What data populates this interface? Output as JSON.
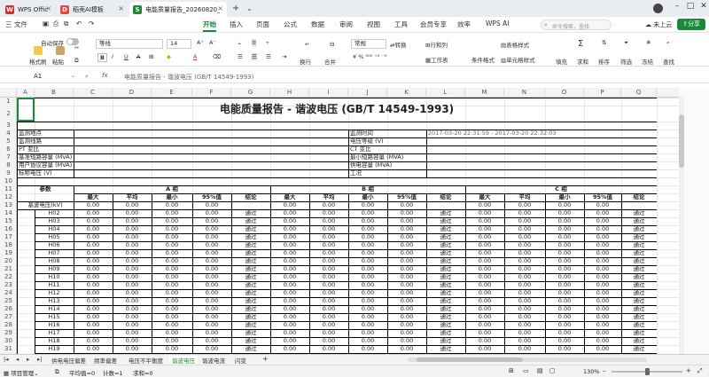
{
  "tabs": [
    {
      "label": "WPS Office",
      "color": "#d93025",
      "glyph": "W"
    },
    {
      "label": "稻壳AI模板",
      "color": "#e8453c",
      "glyph": "D"
    },
    {
      "label": "电能质量报告_20260820_0:",
      "color": "#1a8a3a",
      "glyph": "S"
    }
  ],
  "menu": {
    "file": "三 文件",
    "items": [
      "开始",
      "插入",
      "页面",
      "公式",
      "数据",
      "审阅",
      "视图",
      "工具",
      "会员专享",
      "效率",
      "WPS AI"
    ],
    "active": "开始",
    "search_placeholder": "命令搜索，查找",
    "share": "分享",
    "cloud": "未上云"
  },
  "ribbon": {
    "autosave": "自动保存",
    "font_name": "等线",
    "font_size": "14",
    "format_painter": "格式刷",
    "paste": "粘贴",
    "format": "常规",
    "convert": "转换",
    "rowcol": "行和列",
    "table_style": "表格样式",
    "wrap": "换行",
    "merge": "合并",
    "sheet": "工作表",
    "cond_format": "条件格式",
    "cell_style": "单元格样式",
    "fill": "填充",
    "sum": "求和",
    "sort": "排序",
    "filter": "筛选",
    "freeze": "冻结",
    "find": "查找"
  },
  "formula_bar": {
    "cell_ref": "A1",
    "fx": "fx",
    "content": "电能质量报告 - 谐波电压 (GB/T 14549-1993)"
  },
  "columns": [
    "A",
    "B",
    "C",
    "D",
    "E",
    "F",
    "G",
    "H",
    "I",
    "J",
    "K",
    "L",
    "M",
    "N",
    "O",
    "P",
    "Q"
  ],
  "rows": [
    "1",
    "2",
    "3",
    "4",
    "5",
    "6",
    "7",
    "8",
    "9",
    "10",
    "11",
    "12",
    "13",
    "14",
    "15",
    "16",
    "17",
    "18",
    "19",
    "20",
    "21",
    "22",
    "23",
    "24",
    "25",
    "26",
    "27",
    "28",
    "29",
    "30",
    "31"
  ],
  "sheet": {
    "title": "电能质量报告 - 谐波电压 (GB/T 14549-1993)",
    "info_left": [
      "监测地点",
      "监测线路",
      "PT 变比",
      "基准短路容量 (MVA)",
      "用户协议容量 (MVA)",
      "标称电压 (V)"
    ],
    "info_right": [
      "监测时间",
      "电压等级 (V)",
      "CT 变比",
      "最小短路容量 (MVA)",
      "供电容量 (MVA)",
      "工况"
    ],
    "time_value": "2017-03-20 22:31:59 - 2017-03-20 22:32:03",
    "param_label": "参数",
    "phase_a": "A 相",
    "phase_b": "B 相",
    "phase_c": "C 相",
    "sub_headers": [
      "最大",
      "平均",
      "最小",
      "95%值",
      "结论"
    ],
    "base_label": "基波电压(kV)",
    "harmonics": [
      "H02",
      "H03",
      "H04",
      "H05",
      "H06",
      "H07",
      "H08",
      "H09",
      "H10",
      "H11",
      "H12",
      "H13",
      "H14",
      "H15",
      "H16",
      "H17",
      "H18",
      "H19"
    ],
    "zero": "0.00",
    "pass": "通过"
  },
  "sheet_tabs": [
    "供电电压偏差",
    "频率偏差",
    "电压不平衡度",
    "谐波电压",
    "谐波电流",
    "闪变"
  ],
  "active_sheet": "谐波电压",
  "status": {
    "project": "项目管理",
    "avg": "平均值=0",
    "count": "计数=1",
    "sum": "求和=0",
    "zoom": "130%"
  }
}
